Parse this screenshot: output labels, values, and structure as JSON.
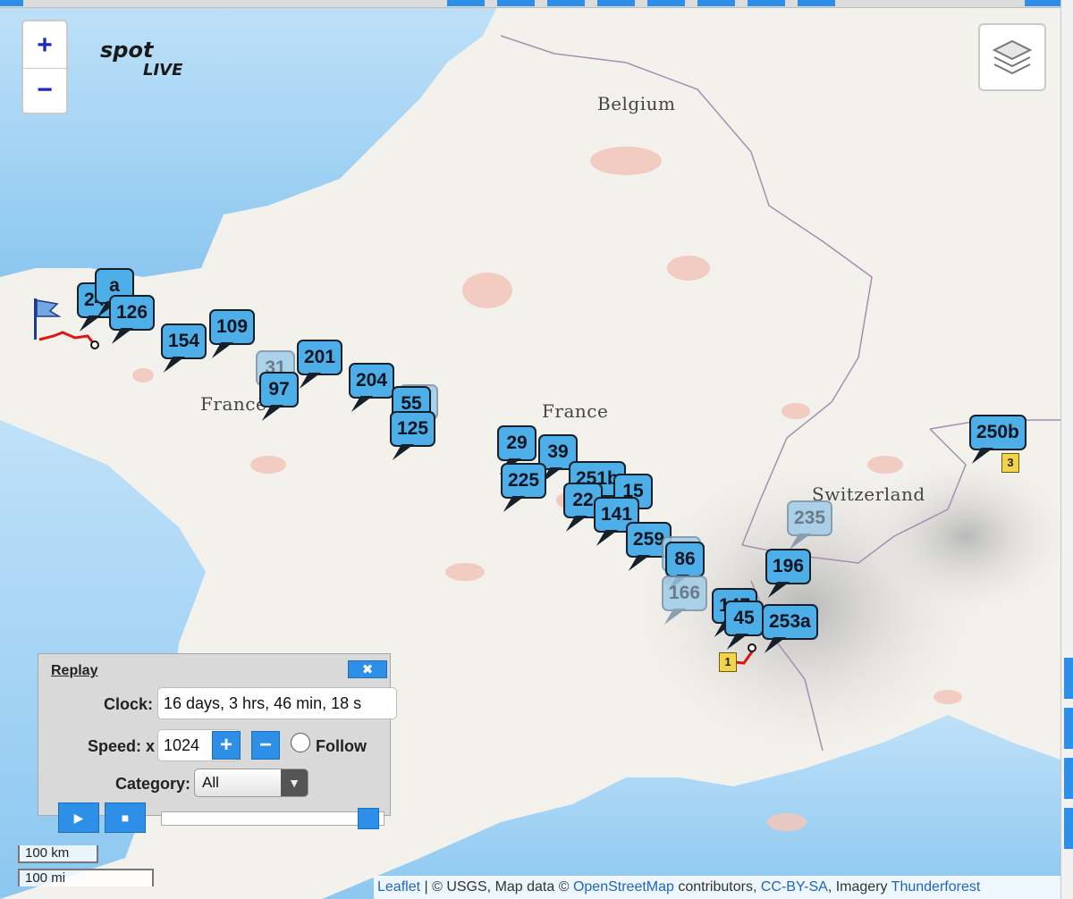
{
  "map": {
    "country_labels": [
      "Belgium",
      "France",
      "France",
      "Switzerland"
    ],
    "zoom_in_label": "+",
    "zoom_out_label": "−",
    "logo_text_top": "spot",
    "logo_text_bottom": "LIVE",
    "route_badge_1": "1",
    "route_badge_3": "3"
  },
  "markers": [
    {
      "label": "245b",
      "faded": false
    },
    {
      "label": "a",
      "faded": false
    },
    {
      "label": "126",
      "faded": false
    },
    {
      "label": "154",
      "faded": false
    },
    {
      "label": "109",
      "faded": false
    },
    {
      "label": "31",
      "faded": true
    },
    {
      "label": "201",
      "faded": false
    },
    {
      "label": "97",
      "faded": false
    },
    {
      "label": "204",
      "faded": false
    },
    {
      "label": "58",
      "faded": true
    },
    {
      "label": "55",
      "faded": false
    },
    {
      "label": "125",
      "faded": false
    },
    {
      "label": "29",
      "faded": false
    },
    {
      "label": "39",
      "faded": false
    },
    {
      "label": "225",
      "faded": false
    },
    {
      "label": "251b",
      "faded": false
    },
    {
      "label": "15",
      "faded": false
    },
    {
      "label": "22",
      "faded": false
    },
    {
      "label": "141",
      "faded": false
    },
    {
      "label": "259",
      "faded": false
    },
    {
      "label": "16",
      "faded": true
    },
    {
      "label": "86",
      "faded": false
    },
    {
      "label": "166",
      "faded": true
    },
    {
      "label": "235",
      "faded": true
    },
    {
      "label": "196",
      "faded": false
    },
    {
      "label": "147",
      "faded": false
    },
    {
      "label": "45",
      "faded": false
    },
    {
      "label": "253a",
      "faded": false
    },
    {
      "label": "250b",
      "faded": false
    }
  ],
  "replay": {
    "title": "Replay",
    "close_label": "✖",
    "clock_label": "Clock:",
    "clock_value": "16 days, 3 hrs, 46 min, 18 s",
    "speed_label": "Speed: x",
    "speed_value": "1024",
    "speed_plus": "+",
    "speed_minus": "−",
    "follow_label": "Follow",
    "follow_checked": false,
    "category_label": "Category:",
    "category_value": "All",
    "play_label": "▶",
    "stop_label": "■",
    "progress_fraction": 0.97
  },
  "scale": {
    "km": "100 km",
    "mi": "100 mi"
  },
  "attribution": {
    "leaflet": "Leaflet",
    "sep": " | © USGS, Map data © ",
    "osm": "OpenStreetMap",
    "contrib": " contributors, ",
    "license": "CC-BY-SA",
    "imagery": ", Imagery ",
    "provider": "Thunderforest"
  },
  "colors": {
    "marker_fill": "#4daee8",
    "accent": "#2d8fe8",
    "route": "#e01414",
    "sea": "#a9d6f5"
  }
}
